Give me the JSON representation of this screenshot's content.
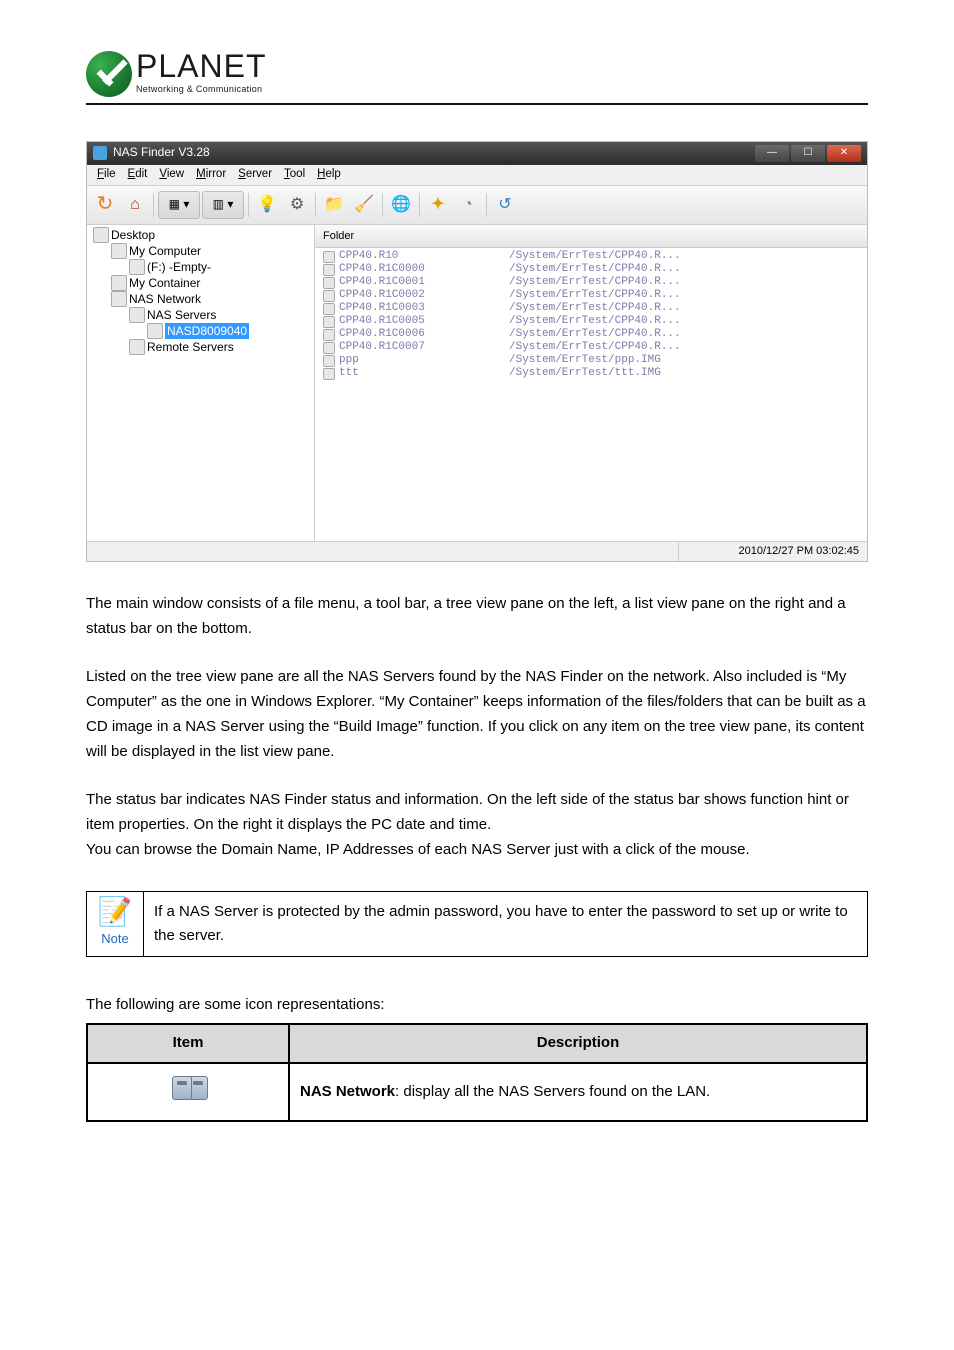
{
  "logo": {
    "brand": "PLANET",
    "tagline": "Networking & Communication"
  },
  "screenshot": {
    "title": "NAS Finder V3.28",
    "menu": [
      "File",
      "Edit",
      "View",
      "Mirror",
      "Server",
      "Tool",
      "Help"
    ],
    "tree": [
      {
        "indent": 0,
        "label": "Desktop"
      },
      {
        "indent": 1,
        "label": "My Computer"
      },
      {
        "indent": 2,
        "label": "(F:) -Empty-"
      },
      {
        "indent": 1,
        "label": "My Container"
      },
      {
        "indent": 1,
        "label": "NAS Network"
      },
      {
        "indent": 2,
        "label": "NAS Servers"
      },
      {
        "indent": 3,
        "label": "NASD8009040",
        "selected": true
      },
      {
        "indent": 2,
        "label": "Remote Servers"
      }
    ],
    "list_header": "Folder",
    "list": [
      {
        "name": "CPP40.R10",
        "path": "/System/ErrTest/CPP40.R..."
      },
      {
        "name": "CPP40.R1C0000",
        "path": "/System/ErrTest/CPP40.R..."
      },
      {
        "name": "CPP40.R1C0001",
        "path": "/System/ErrTest/CPP40.R..."
      },
      {
        "name": "CPP40.R1C0002",
        "path": "/System/ErrTest/CPP40.R..."
      },
      {
        "name": "CPP40.R1C0003",
        "path": "/System/ErrTest/CPP40.R..."
      },
      {
        "name": "CPP40.R1C0005",
        "path": "/System/ErrTest/CPP40.R..."
      },
      {
        "name": "CPP40.R1C0006",
        "path": "/System/ErrTest/CPP40.R..."
      },
      {
        "name": "CPP40.R1C0007",
        "path": "/System/ErrTest/CPP40.R..."
      },
      {
        "name": "ppp",
        "path": "/System/ErrTest/ppp.IMG"
      },
      {
        "name": "ttt",
        "path": "/System/ErrTest/ttt.IMG"
      }
    ],
    "status_datetime": "2010/12/27  PM 03:02:45"
  },
  "paragraphs": {
    "p1": "The main window consists of a file menu, a tool bar, a tree view pane on the left, a list view pane on the right and a status bar on the bottom.",
    "p2": "Listed on the tree view pane are all the NAS Servers found by the NAS Finder on the network. Also included is “My Computer” as the one in Windows Explorer. “My Container” keeps information of the files/folders that can be built as a CD image in a NAS Server using the “Build Image” function. If you click on any item on the tree view pane, its content will be displayed in the list view pane.",
    "p3": "The status bar indicates NAS Finder status and information. On the left side of the status bar shows function hint or item properties. On the right it displays the PC date and time.\nYou can browse the Domain Name, IP Addresses of each NAS Server just with a click of the mouse."
  },
  "note": {
    "label": "Note",
    "text": "If a NAS Server is protected by the admin password, you have to enter the password to set up or write to the server."
  },
  "icon_table": {
    "caption": "The following are some icon representations:",
    "head_item": "Item",
    "head_desc": "Description",
    "rows": [
      {
        "icon_name": "nas-network-icon",
        "desc_bold": "NAS Network",
        "desc_rest": ": display all the NAS Servers found on the LAN."
      }
    ]
  }
}
